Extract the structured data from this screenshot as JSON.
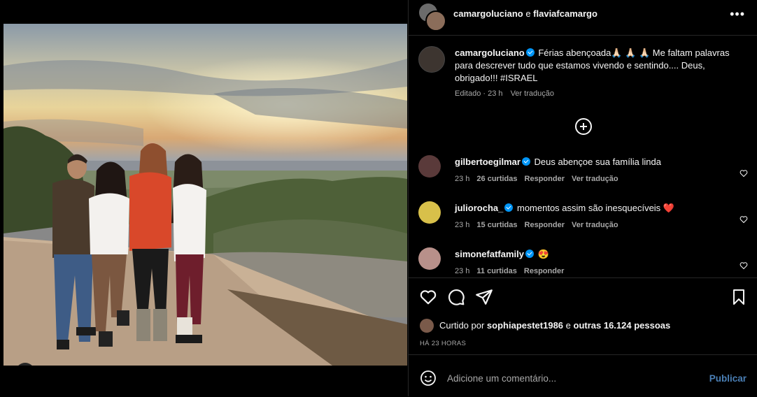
{
  "post": {
    "header": {
      "author": "camargoluciano",
      "conj": " e ",
      "coauthor": "flaviafcamargo",
      "more_icon": "more-horizontal-icon"
    },
    "caption": {
      "username": "camargoluciano",
      "text": " Férias abençoada🙏🏻 🙏🏻 🙏🏻 Me faltam palavras para descrever tudo que estamos vivendo e sentindo.... Deus, obrigado!!! #ISRAEL",
      "edited": "Editado",
      "time": "23 h",
      "translate": "Ver tradução"
    },
    "comments": [
      {
        "username": "gilbertoegilmar",
        "text": "Deus abençoe sua família linda",
        "time": "23 h",
        "likes": "26 curtidas",
        "reply": "Responder",
        "translate": "Ver tradução"
      },
      {
        "username": "juliorocha_",
        "text": "momentos assim são inesquecíveis ❤️",
        "time": "23 h",
        "likes": "15 curtidas",
        "reply": "Responder",
        "translate": "Ver tradução"
      },
      {
        "username": "simonefatfamily",
        "text": "😍",
        "time": "23 h",
        "likes": "11 curtidas",
        "reply": "Responder",
        "translate": ""
      }
    ],
    "likes": {
      "prefix": "Curtido por ",
      "user": "sophiapestet1986",
      "middle": " e ",
      "others": "outras 16.124 pessoas"
    },
    "posted_ago": "HÁ 23 HORAS",
    "add_comment": {
      "placeholder": "Adicione um comentário...",
      "publish": "Publicar"
    }
  },
  "colors": {
    "verified": "#0095f6",
    "publish": "#4a7fb5",
    "background": "#000000",
    "divider": "#262626"
  }
}
